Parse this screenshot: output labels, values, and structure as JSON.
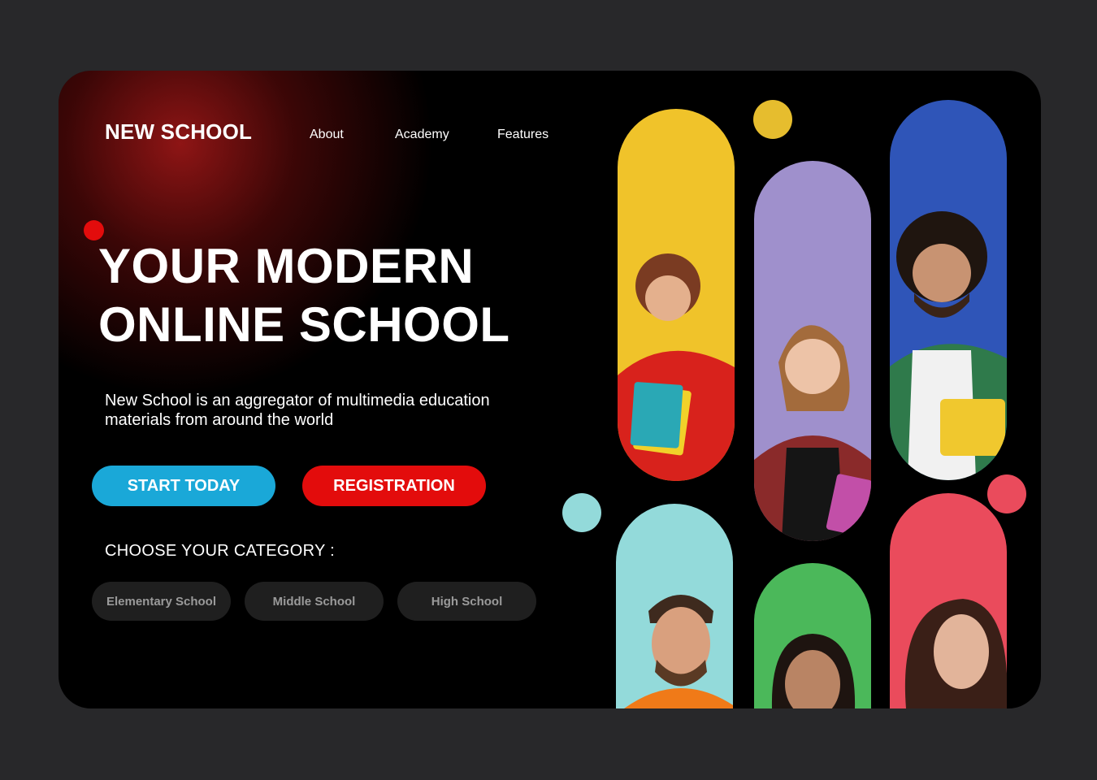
{
  "brand": {
    "logo": "NEW SCHOOL"
  },
  "nav": {
    "items": [
      "About",
      "Academy",
      "Features"
    ]
  },
  "hero": {
    "line1": "YOUR MODERN",
    "line2": "ONLINE SCHOOL",
    "description": "New School is an aggregator of multimedia education materials from around the world"
  },
  "buttons": {
    "start": "START TODAY",
    "register": "REGISTRATION"
  },
  "category": {
    "label": "CHOOSE YOUR CATEGORY :",
    "options": [
      "Elementary School",
      "Middle School",
      "High School"
    ]
  },
  "colors": {
    "background": "#28282a",
    "card": "#000000",
    "accent_red": "#e30c0c",
    "accent_blue": "#1aa8d8",
    "yellow": "#f0c32a",
    "lavender": "#9f90cc",
    "blue": "#2f55b8",
    "cyan": "#93dada",
    "green": "#4bb85a",
    "pink": "#ea4b5c"
  }
}
